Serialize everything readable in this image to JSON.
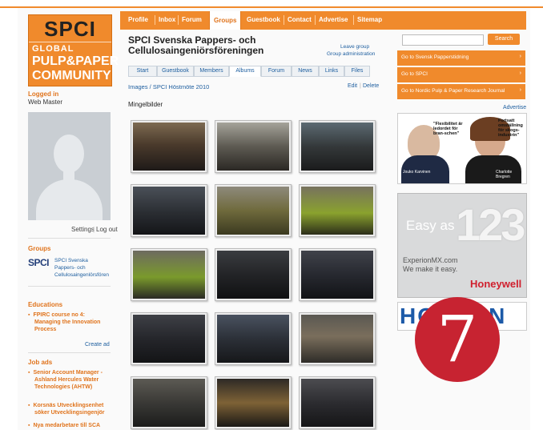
{
  "logo": {
    "line1": "SPCI",
    "line2": "GLOBAL",
    "line3": "PULP&PAPER",
    "line4": "COMMUNITY"
  },
  "nav": {
    "items": [
      "Profile",
      "Inbox",
      "Forum",
      "Groups",
      "Guestbook",
      "Contact",
      "Advertise",
      "Sitemap"
    ],
    "active": "Groups"
  },
  "sidebar": {
    "logged_in_label": "Logged in",
    "user_name": "Web Master",
    "settings": "Settings",
    "logout": "Log out",
    "groups_label": "Groups",
    "group_logo_text": "SPCI",
    "group_name": [
      "SPCI Svenska",
      "Pappers- och",
      "Cellulosaingenlörsfören"
    ],
    "educations_label": "Educations",
    "educations": [
      "FPIRC course no 4:",
      "Managing the Innovation",
      "Process"
    ],
    "create_ad": "Create ad",
    "job_ads_label": "Job ads",
    "job_ads": [
      [
        "Senior Account Manager -",
        "Ashland Hercules Water",
        "Technologies (AHTW)"
      ],
      [
        "Korsnäs Utvecklingsenhet",
        "söker Utvecklingsingenjör"
      ],
      [
        "Nya medarbetare till SCA"
      ]
    ]
  },
  "group": {
    "title_line1": "SPCI Svenska Pappers- och",
    "title_line2": "Cellulosaingeniörsföreningen",
    "leave_group": "Leave group",
    "group_admin": "Group administration",
    "tabs": [
      "Start",
      "Guestbook",
      "Members",
      "Albums",
      "Forum",
      "News",
      "Links",
      "Files"
    ],
    "active_tab": "Albums",
    "breadcrumb": "Images / SPCI Höstmöte 2010",
    "edit": "Edit",
    "delete": "Delete",
    "album_title": "Mingelbilder"
  },
  "right": {
    "search_button": "Search",
    "links": [
      "Go to Svensk Papperstidning",
      "Go to SPCI",
      "Go to Nordic Pulp & Paper Research Journal"
    ],
    "advertise": "Advertise",
    "ad1": {
      "quote_left": "\"Flexibilitet är ledordet för bran-schen\"",
      "quote_right": "Fortsatt omställning för skogs-industrin\"",
      "name_left": "Jouko Karvinen",
      "name_right": "Charlotte Bregren"
    },
    "ad2": {
      "easy": "Easy as",
      "numbers": "123",
      "url": "ExperionMX.com",
      "tagline": "We make it easy.",
      "brand": "Honeywell"
    },
    "ad3": {
      "text": "HOLMEN"
    }
  },
  "badge": {
    "number": "7"
  },
  "colors": {
    "accent": "#f08a2c",
    "link": "#2060a0",
    "badge": "#c72331"
  }
}
